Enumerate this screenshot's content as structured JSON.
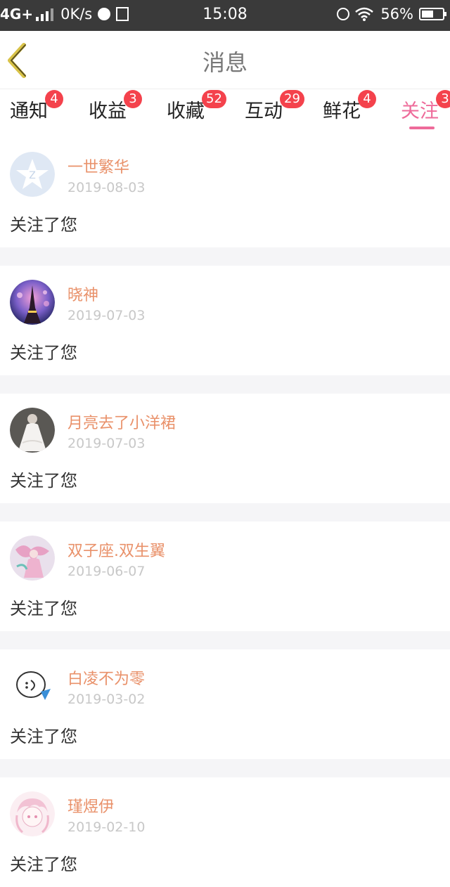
{
  "status_bar": {
    "network": "4G+",
    "speed": "0K/s",
    "time": "15:08",
    "battery": "56%",
    "battery_level": 0.56
  },
  "header": {
    "title": "消息",
    "back_icon": "chevron-left-icon"
  },
  "tabs": [
    {
      "label": "通知",
      "badge": "4"
    },
    {
      "label": "收益",
      "badge": "3"
    },
    {
      "label": "收藏",
      "badge": "52"
    },
    {
      "label": "互动",
      "badge": "29"
    },
    {
      "label": "鲜花",
      "badge": "4"
    },
    {
      "label": "关注",
      "badge": "3",
      "active": true
    }
  ],
  "items": [
    {
      "name": "一世繁华",
      "date": "2019-08-03",
      "message": "关注了您"
    },
    {
      "name": "晓神",
      "date": "2019-07-03",
      "message": "关注了您"
    },
    {
      "name": "月亮去了小洋裙",
      "date": "2019-07-03",
      "message": "关注了您"
    },
    {
      "name": "双子座.双生翼",
      "date": "2019-06-07",
      "message": "关注了您"
    },
    {
      "name": "白凌不为零",
      "date": "2019-03-02",
      "message": "关注了您"
    },
    {
      "name": "瑾煜伊",
      "date": "2019-02-10",
      "message": "关注了您"
    }
  ],
  "colors": {
    "accent": "#ee6b9a",
    "username": "#e9916a",
    "badge": "#f4424c",
    "status_bar": "#3a3a3a"
  }
}
